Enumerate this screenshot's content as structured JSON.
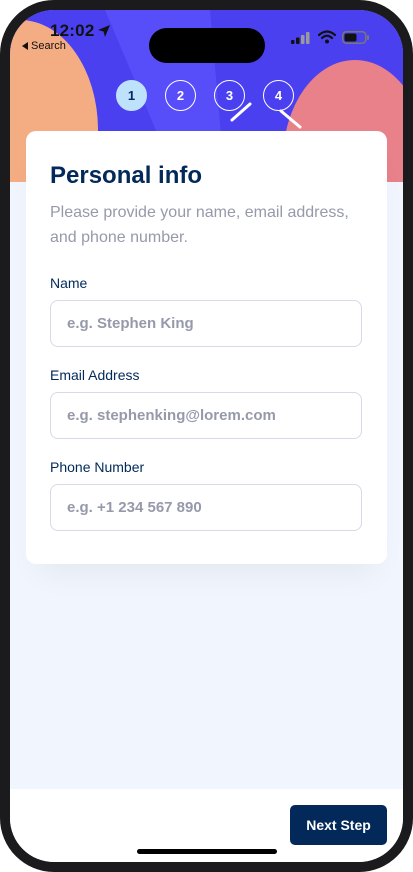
{
  "status_bar": {
    "time": "12:02",
    "back_label": "Search"
  },
  "steps": [
    {
      "number": "1",
      "active": true
    },
    {
      "number": "2",
      "active": false
    },
    {
      "number": "3",
      "active": false
    },
    {
      "number": "4",
      "active": false
    }
  ],
  "form": {
    "title": "Personal info",
    "subtitle": "Please provide your name, email address, and phone number.",
    "fields": {
      "name": {
        "label": "Name",
        "value": "",
        "placeholder": "e.g. Stephen King"
      },
      "email": {
        "label": "Email Address",
        "value": "",
        "placeholder": "e.g. stephenking@lorem.com"
      },
      "phone": {
        "label": "Phone Number",
        "value": "",
        "placeholder": "e.g. +1 234 567 890"
      }
    }
  },
  "footer": {
    "next_label": "Next Step"
  },
  "colors": {
    "hero_blue": "#4a40f0",
    "active_step": "#bfe2fc",
    "marine_blue": "#022959",
    "orange_blob": "#f4ad83",
    "pink_blob": "#e9818a",
    "background": "#f0f5fe"
  }
}
